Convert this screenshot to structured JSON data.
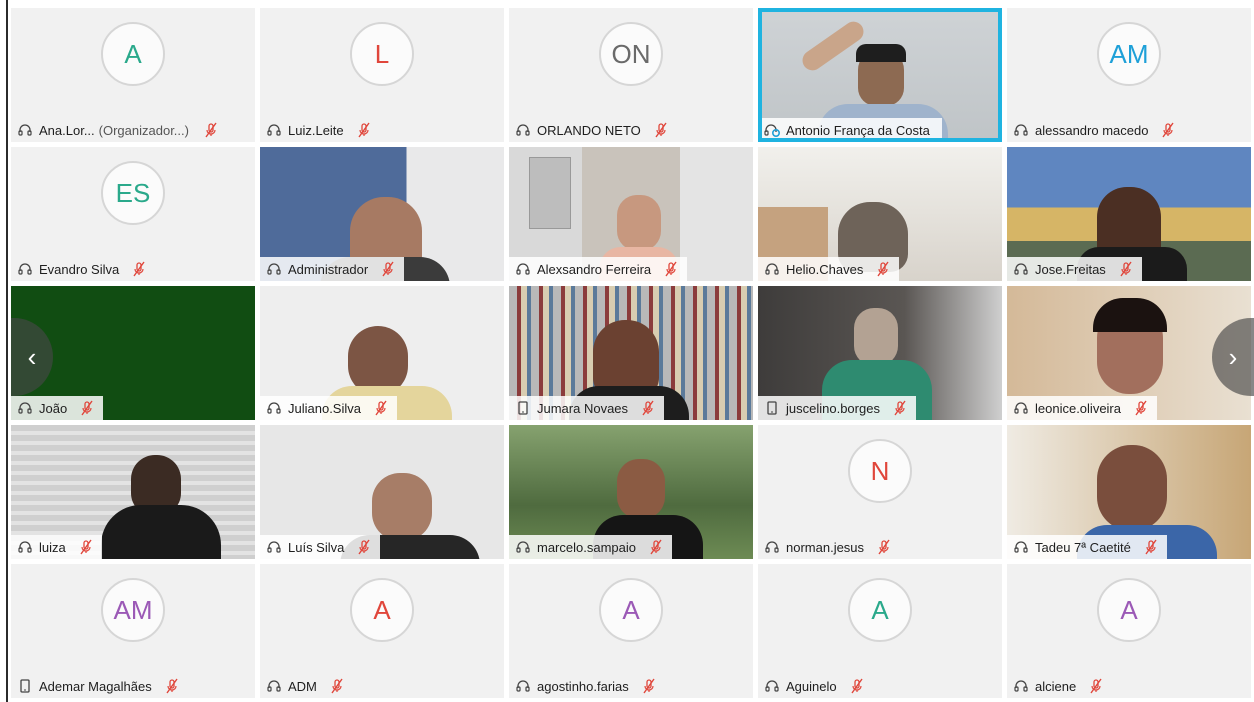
{
  "participants": [
    {
      "name": "Ana.Lor...",
      "role": "(Organizador...)",
      "initials": "A",
      "initials_color": "#2aa98b",
      "device": "headset",
      "video": false,
      "muted": true
    },
    {
      "name": "Luiz.Leite",
      "initials": "L",
      "initials_color": "#e0463b",
      "device": "headset",
      "video": false,
      "muted": true
    },
    {
      "name": "ORLANDO NETO",
      "initials": "ON",
      "initials_color": "#6a6a6a",
      "device": "headset",
      "video": false,
      "muted": true
    },
    {
      "name": "Antonio França da Costa",
      "device": "speaking",
      "video": true,
      "active": true,
      "muted": false,
      "scene": "man-wave"
    },
    {
      "name": "alessandro macedo",
      "initials": "AM",
      "initials_color": "#1ea0d8",
      "device": "headset",
      "video": false,
      "muted": true
    },
    {
      "name": "Evandro Silva",
      "initials": "ES",
      "initials_color": "#2aa98b",
      "device": "headset",
      "video": false,
      "muted": true
    },
    {
      "name": "Administrador",
      "device": "headset",
      "video": true,
      "muted": true,
      "scene": "room-blue"
    },
    {
      "name": "Alexsandro Ferreira",
      "device": "headset",
      "video": true,
      "muted": true,
      "scene": "room-door"
    },
    {
      "name": "Helio.Chaves",
      "device": "headset",
      "video": true,
      "muted": true,
      "scene": "ceiling"
    },
    {
      "name": "Jose.Freitas",
      "device": "headset",
      "video": true,
      "muted": true,
      "scene": "city"
    },
    {
      "name": "João",
      "device": "headset",
      "video": true,
      "muted": true,
      "scene": "green"
    },
    {
      "name": "Juliano.Silva",
      "device": "headset",
      "video": true,
      "muted": true,
      "scene": "bald"
    },
    {
      "name": "Jumara Novaes",
      "device": "phone",
      "video": true,
      "muted": true,
      "scene": "books"
    },
    {
      "name": "juscelino.borges",
      "device": "phone",
      "video": true,
      "muted": true,
      "scene": "dark-room"
    },
    {
      "name": "leonice.oliveira",
      "device": "headset",
      "video": true,
      "muted": true,
      "scene": "smile"
    },
    {
      "name": "luiza",
      "device": "headset",
      "video": true,
      "muted": true,
      "scene": "blinds"
    },
    {
      "name": "Luís Silva",
      "device": "headset",
      "video": true,
      "muted": true,
      "scene": "glasses"
    },
    {
      "name": "marcelo.sampaio",
      "device": "headset",
      "video": true,
      "muted": true,
      "scene": "park"
    },
    {
      "name": "norman.jesus",
      "initials": "N",
      "initials_color": "#e0463b",
      "device": "headset",
      "video": false,
      "muted": true
    },
    {
      "name": "Tadeu 7ª Caetité",
      "device": "headset",
      "video": true,
      "muted": true,
      "scene": "tadeu"
    },
    {
      "name": "Ademar Magalhães",
      "initials": "AM",
      "initials_color": "#9b59b6",
      "device": "phone",
      "video": false,
      "muted": true
    },
    {
      "name": "ADM",
      "initials": "A",
      "initials_color": "#e0463b",
      "device": "headset",
      "video": false,
      "muted": true
    },
    {
      "name": "agostinho.farias",
      "initials": "A",
      "initials_color": "#9b59b6",
      "device": "headset",
      "video": false,
      "muted": true
    },
    {
      "name": "Aguinelo",
      "initials": "A",
      "initials_color": "#2aa98b",
      "device": "headset",
      "video": false,
      "muted": true
    },
    {
      "name": "alciene",
      "initials": "A",
      "initials_color": "#9b59b6",
      "device": "headset",
      "video": false,
      "muted": true
    }
  ],
  "nav": {
    "prev_icon": "‹",
    "next_icon": "›"
  },
  "colors": {
    "active_border": "#1fb3e0",
    "muted_mic": "#e0463b"
  }
}
